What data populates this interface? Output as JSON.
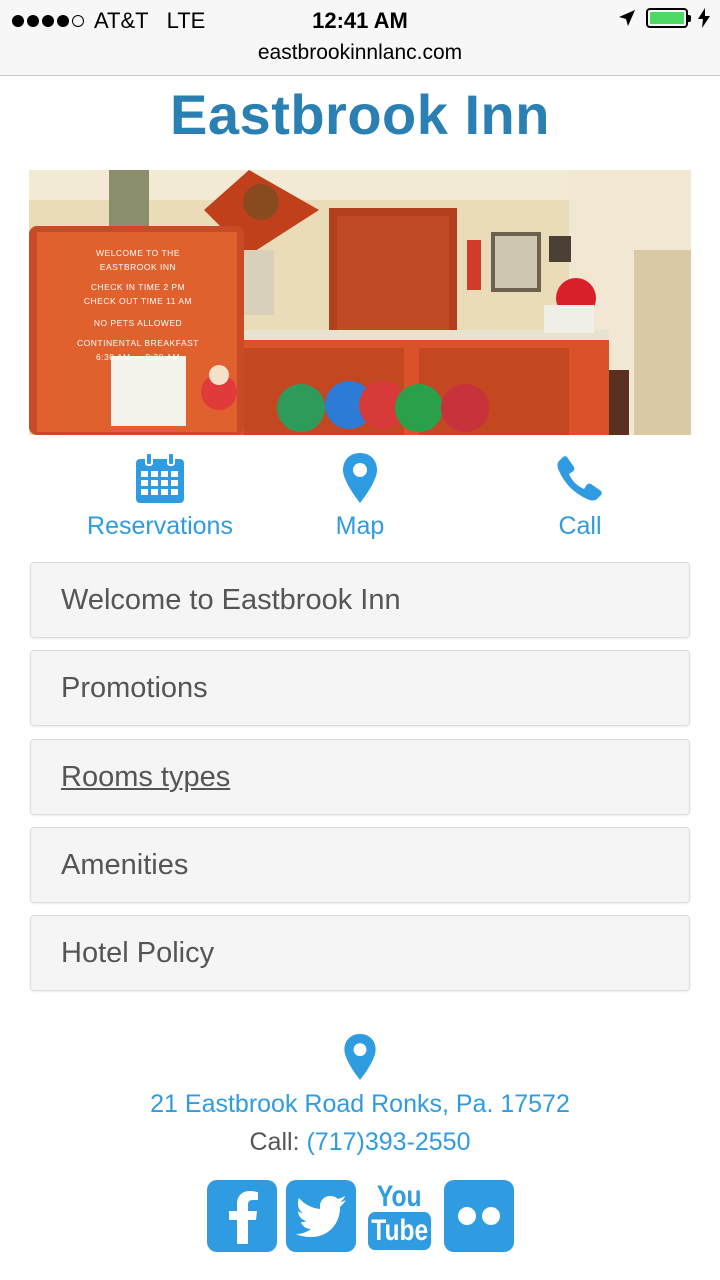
{
  "status_bar": {
    "carrier": "AT&T",
    "network": "LTE",
    "time": "12:41 AM",
    "battery_color": "#4cd964",
    "icons": [
      "signal-dots-icon",
      "location-arrow-icon",
      "battery-icon",
      "charging-bolt-icon"
    ]
  },
  "browser": {
    "url": "eastbrookinnlanc.com"
  },
  "page": {
    "title": "Eastbrook Inn",
    "title_color": "#2a7fb3",
    "accent_color": "#2f9be0"
  },
  "hero": {
    "sign_lines": [
      "WELCOME TO THE",
      "EASTBROOK INN",
      "CHECK IN TIME  2 PM",
      "CHECK OUT TIME  11 AM",
      "NO PETS ALLOWED",
      "CONTINENTAL BREAKFAST",
      "6:30 AM — 9:30 AM"
    ]
  },
  "quick_actions": [
    {
      "label": "Reservations",
      "icon": "calendar-icon"
    },
    {
      "label": "Map",
      "icon": "map-pin-icon"
    },
    {
      "label": "Call",
      "icon": "phone-icon"
    }
  ],
  "sections": [
    {
      "label": "Welcome to Eastbrook Inn"
    },
    {
      "label": "Promotions"
    },
    {
      "label": "Rooms types"
    },
    {
      "label": "Amenities"
    },
    {
      "label": "Hotel Policy"
    }
  ],
  "footer": {
    "address": "21 Eastbrook Road Ronks, Pa. 17572",
    "call_label": "Call:",
    "phone": "(717)393-2550",
    "social": [
      {
        "icon": "facebook-icon"
      },
      {
        "icon": "twitter-icon"
      },
      {
        "icon": "youtube-icon",
        "text_top": "You",
        "text_bottom": "Tube"
      },
      {
        "icon": "flickr-icon"
      }
    ]
  }
}
